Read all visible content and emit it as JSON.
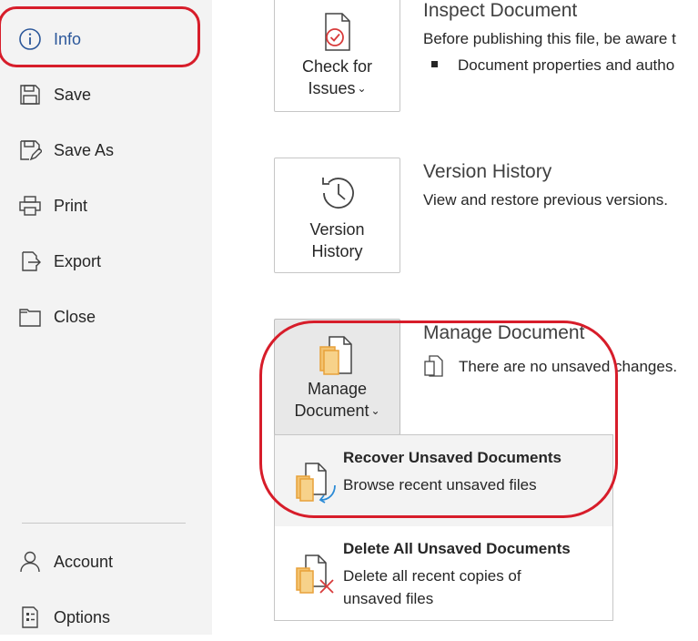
{
  "sidebar": {
    "items": [
      {
        "label": "Info",
        "icon": "info-icon"
      },
      {
        "label": "Save",
        "icon": "save-icon"
      },
      {
        "label": "Save As",
        "icon": "save-as-icon"
      },
      {
        "label": "Print",
        "icon": "print-icon"
      },
      {
        "label": "Export",
        "icon": "export-icon"
      },
      {
        "label": "Close",
        "icon": "folder-icon"
      }
    ],
    "bottom_items": [
      {
        "label": "Account",
        "icon": "person-icon"
      },
      {
        "label": "Options",
        "icon": "options-icon"
      }
    ],
    "active": "Info"
  },
  "inspect": {
    "button_line1": "Check for",
    "button_line2": "Issues",
    "title": "Inspect Document",
    "desc": "Before publishing this file, be aware t",
    "bullet": "Document properties and autho"
  },
  "version": {
    "button_line1": "Version",
    "button_line2": "History",
    "title": "Version History",
    "desc": "View and restore previous versions."
  },
  "manage": {
    "button_line1": "Manage",
    "button_line2": "Document",
    "title": "Manage Document",
    "status": "There are no unsaved changes."
  },
  "manage_menu": {
    "items": [
      {
        "title": "Recover Unsaved Documents",
        "desc": "Browse recent unsaved files"
      },
      {
        "title": "Delete All Unsaved Documents",
        "desc": "Delete all recent copies of unsaved files"
      }
    ]
  },
  "colors": {
    "accent": "#2b579a",
    "highlight_ring": "#d71d2a",
    "doc_orange": "#e8a13a",
    "delete_red": "#d83b3b",
    "recover_blue": "#2b8bd6"
  }
}
